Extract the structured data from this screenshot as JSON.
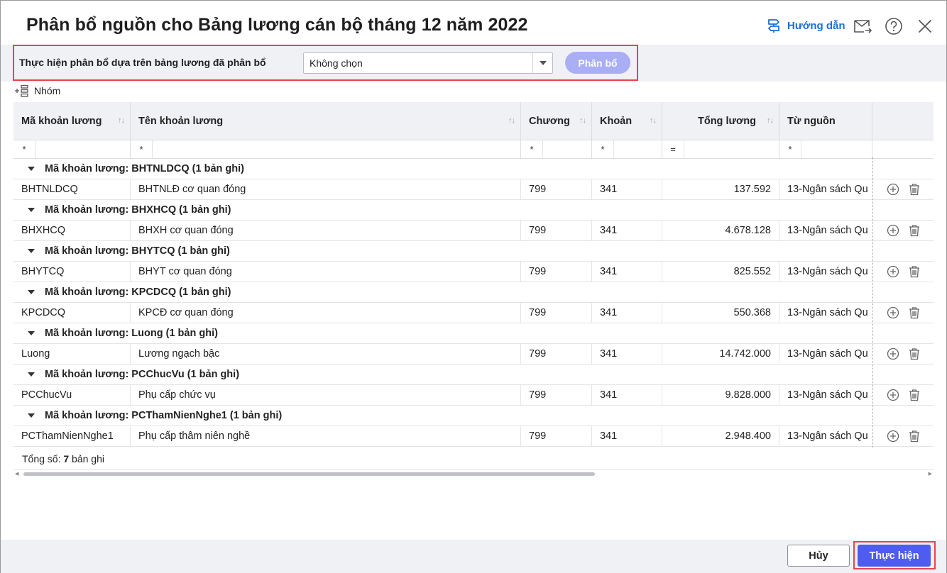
{
  "dialog": {
    "title": "Phân bổ nguồn cho Bảng lương cán bộ tháng 12 năm 2022",
    "help_label": "Hướng dẫn"
  },
  "allocation_bar": {
    "label": "Thực hiện phân bổ dựa trên bảng lương đã phân bổ",
    "select_value": "Không chọn",
    "allocate_button": "Phân bổ"
  },
  "group_toggle_label": "Nhóm",
  "columns": {
    "ma": "Mã khoản lương",
    "ten": "Tên khoản lương",
    "chuong": "Chương",
    "khoan": "Khoản",
    "tong": "Tổng lương",
    "nguon": "Từ nguồn"
  },
  "filters": {
    "ma": "*",
    "ten": "*",
    "chuong": "*",
    "khoan": "*",
    "tong": "=",
    "nguon": "*"
  },
  "groups": [
    {
      "label": "Mã khoản lương: BHTNLDCQ (1 bản ghi)",
      "row": {
        "ma": "BHTNLDCQ",
        "ten": "BHTNLĐ cơ quan đóng",
        "chuong": "799",
        "khoan": "341",
        "tong": "137.592",
        "nguon": "13-Ngân sách Qu"
      }
    },
    {
      "label": "Mã khoản lương: BHXHCQ (1 bản ghi)",
      "row": {
        "ma": "BHXHCQ",
        "ten": "BHXH cơ quan đóng",
        "chuong": "799",
        "khoan": "341",
        "tong": "4.678.128",
        "nguon": "13-Ngân sách Qu"
      }
    },
    {
      "label": "Mã khoản lương: BHYTCQ (1 bản ghi)",
      "row": {
        "ma": "BHYTCQ",
        "ten": "BHYT cơ quan đóng",
        "chuong": "799",
        "khoan": "341",
        "tong": "825.552",
        "nguon": "13-Ngân sách Qu"
      }
    },
    {
      "label": "Mã khoản lương: KPCDCQ (1 bản ghi)",
      "row": {
        "ma": "KPCDCQ",
        "ten": "KPCĐ cơ quan đóng",
        "chuong": "799",
        "khoan": "341",
        "tong": "550.368",
        "nguon": "13-Ngân sách Qu"
      }
    },
    {
      "label": "Mã khoản lương: Luong (1 bản ghi)",
      "row": {
        "ma": "Luong",
        "ten": "Lương ngạch bậc",
        "chuong": "799",
        "khoan": "341",
        "tong": "14.742.000",
        "nguon": "13-Ngân sách Qu"
      }
    },
    {
      "label": "Mã khoản lương: PCChucVu (1 bản ghi)",
      "row": {
        "ma": "PCChucVu",
        "ten": "Phụ cấp chức vụ",
        "chuong": "799",
        "khoan": "341",
        "tong": "9.828.000",
        "nguon": "13-Ngân sách Qu"
      }
    },
    {
      "label": "Mã khoản lương: PCThamNienNghe1 (1 bản ghi)",
      "row": {
        "ma": "PCThamNienNghe1",
        "ten": "Phụ cấp thâm niên nghề",
        "chuong": "799",
        "khoan": "341",
        "tong": "2.948.400",
        "nguon": "13-Ngân sách Qu"
      }
    }
  ],
  "footer": {
    "total_prefix": "Tổng số: ",
    "total_count": "7",
    "total_suffix": " bản ghi"
  },
  "buttons": {
    "cancel": "Hủy",
    "confirm": "Thực hiện"
  },
  "colors": {
    "accent": "#4e5cf0",
    "disabled_accent": "#a9aef5",
    "highlight": "#e8434b",
    "link": "#1c6fd1"
  }
}
